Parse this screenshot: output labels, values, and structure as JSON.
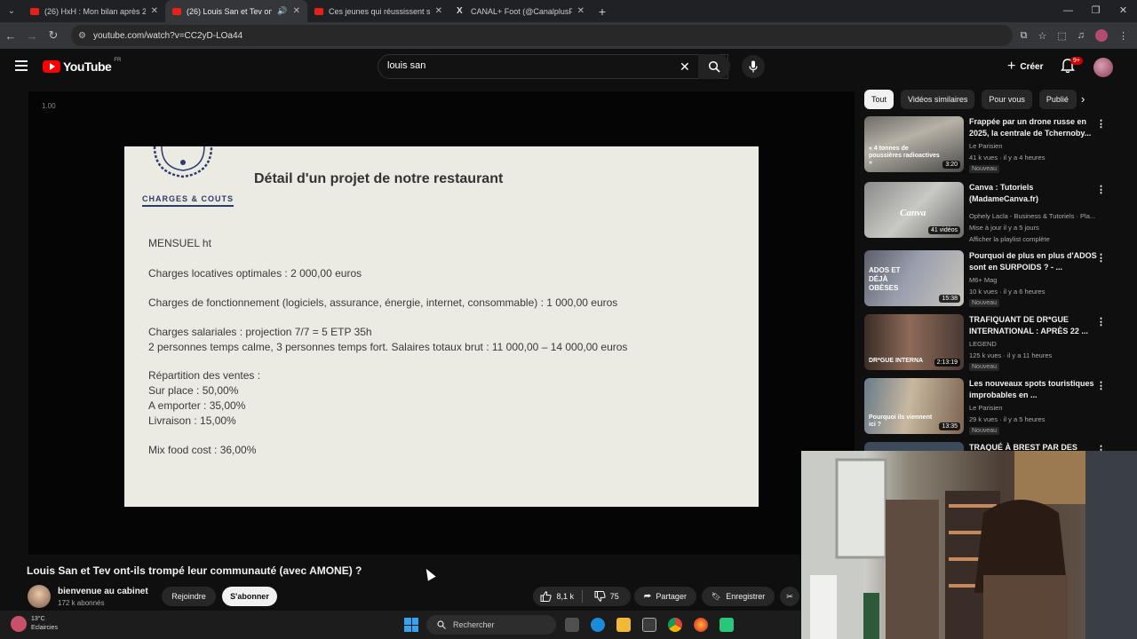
{
  "browser": {
    "tabs": [
      {
        "title": "(26) HxH : Mon bilan après 25 a",
        "active": false
      },
      {
        "title": "(26) Louis San et Tev ont-ils",
        "active": true
      },
      {
        "title": "Ces jeunes qui réussissent sans",
        "active": false
      },
      {
        "title": "CANAL+ Foot (@CanalplusFoot)",
        "active": false
      }
    ],
    "url": "youtube.com/watch?v=CC2yD-LOa44"
  },
  "header": {
    "logo": "YouTube",
    "country": "FR",
    "search_value": "louis san",
    "create_label": "Créer",
    "notif_count": "9+"
  },
  "player": {
    "speed": "1.00",
    "slide": {
      "logo_label": "CHARGES & COUTS",
      "title": "Détail d'un projet de notre restaurant",
      "lines": [
        "MENSUEL ht",
        "Charges locatives optimales : 2 000,00 euros",
        "Charges de fonctionnement (logiciels, assurance, énergie, internet, consommable) : 1 000,00 euros",
        "Charges salariales : projection 7/7 = 5 ETP 35h",
        "2 personnes temps calme, 3 personnes temps fort. Salaires totaux brut : 11 000,00 – 14 000,00 euros",
        "Répartition des ventes :",
        "Sur place : 50,00%",
        "A emporter : 35,00%",
        "Livraison : 15,00%",
        "Mix food cost : 36,00%"
      ]
    }
  },
  "video": {
    "title": "Louis San et Tev ont-ils trompé leur communauté (avec AMONE) ?",
    "channel": "bienvenue au cabinet",
    "subscribers": "172 k abonnés",
    "join_label": "Rejoindre",
    "subscribe_label": "S'abonner",
    "likes": "8,1 k",
    "dislikes": "75",
    "share_label": "Partager",
    "save_label": "Enregistrer"
  },
  "sidebar": {
    "chips": [
      "Tout",
      "Vidéos similaires",
      "Pour vous",
      "Publié"
    ],
    "items": [
      {
        "title": "Frappée par un drone russe en 2025, la centrale de Tchernoby...",
        "channel": "Le Parisien",
        "meta": "41 k vues · il y a 4 heures",
        "badge": "Nouveau",
        "duration": "3:20",
        "thumb_text": "« 4 tonnes de poussières radioactives »"
      },
      {
        "title": "Canva : Tutoriels (MadameCanva.fr)",
        "channel": "Ophely Lacla - Business & Tutoriels · Pla...",
        "meta": "Mise à jour il y a 5 jours",
        "extra": "Afficher la playlist complète",
        "duration": "41 vidéos",
        "thumb_text": "Canva"
      },
      {
        "title": "Pourquoi de plus en plus d'ADOS sont en SURPOIDS ? - ...",
        "channel": "M6+ Mag",
        "meta": "10 k vues · il y a 6 heures",
        "badge": "Nouveau",
        "duration": "15:38",
        "thumb_text": "ADOS ET DÉJÀ OBÈSES"
      },
      {
        "title": "TRAFIQUANT DE DR*GUE INTERNATIONAL : APRÈS 22 ...",
        "channel": "LEGEND",
        "meta": "125 k vues · il y a 11 heures",
        "badge": "Nouveau",
        "duration": "2:13:19",
        "thumb_text": "DR*GUE INTERNA"
      },
      {
        "title": "Les nouveaux spots touristiques improbables en ...",
        "channel": "Le Parisien",
        "meta": "29 k vues · il y a 5 heures",
        "badge": "Nouveau",
        "duration": "13:35",
        "thumb_text": "Pourquoi ils viennent ici ?"
      },
      {
        "title": "TRAQUÉ À BREST PAR DES",
        "channel": "",
        "meta": ""
      }
    ]
  },
  "taskbar": {
    "temp": "13°C",
    "weather": "Eclaircies",
    "search_label": "Rechercher"
  }
}
